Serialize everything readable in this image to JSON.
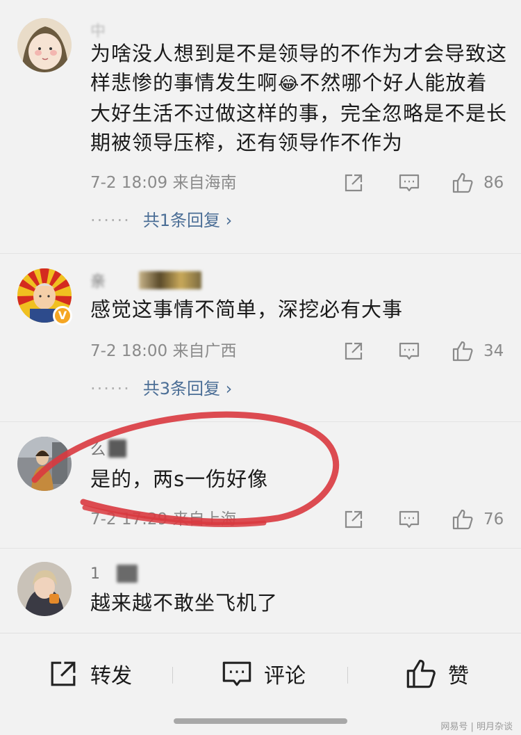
{
  "comments": [
    {
      "username": "中",
      "text": "为啥没人想到是不是领导的不作为才会导致这样悲惨的事情发生啊",
      "emoji": "😂",
      "text2": "不然哪个好人能放着大好生活不过做这样的事，完全忽略是不是长期被领导压榨，还有领导作不作为",
      "meta": "7-2 18:09  来自海南",
      "likes": "86",
      "replies": "共1条回复 ›"
    },
    {
      "username": "亲　　",
      "text": "感觉这事情不简单，深挖必有大事",
      "meta": "7-2 18:00  来自广西",
      "likes": "34",
      "replies": "共3条回复 ›",
      "verified": "V"
    },
    {
      "username": "么",
      "text": "是的，两s一伤好像",
      "meta": "7-2 17:29  来自上海",
      "likes": "76"
    },
    {
      "username": "1",
      "text": "越来越不敢坐飞机了"
    }
  ],
  "dots": "······",
  "bottom_bar": {
    "repost": "转发",
    "comment": "评论",
    "like": "赞"
  },
  "watermark": "网易号 | 明月杂谈",
  "colors": {
    "background": "#f2f2f2",
    "reply_link": "#4b6e96",
    "annotation_red": "#d9393f",
    "verified_badge": "#f5a623"
  },
  "icons": [
    "share-icon",
    "comment-icon",
    "like-icon"
  ]
}
